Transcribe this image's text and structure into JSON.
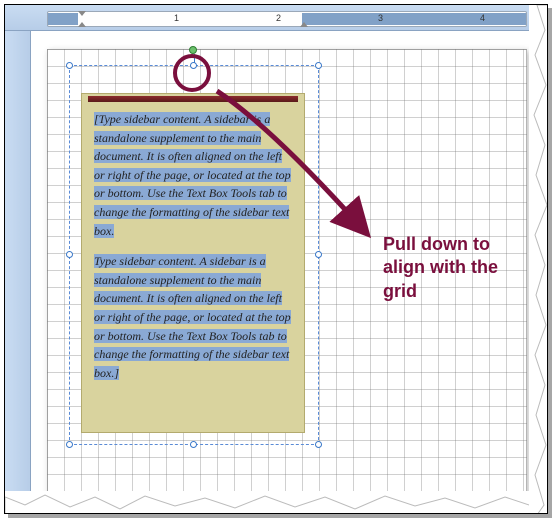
{
  "ruler": {
    "numbers": [
      "1",
      "2",
      "3",
      "4"
    ]
  },
  "textbox": {
    "para1": "[Type sidebar content. A sidebar is a standalone supplement to the main document. It is often aligned on the left or right of the page, or located at the top or bottom. Use the Text Box Tools tab to change the formatting of the sidebar text box.",
    "para2": "Type sidebar content. A sidebar is a standalone supplement to the main document. It is often aligned on the left or right of the page, or located at the top or bottom. Use the Text Box Tools tab to change the formatting of the sidebar text box.]"
  },
  "annotation": {
    "text": "Pull down to align with the grid"
  },
  "colors": {
    "annotation": "#7a0f3d",
    "selection": "#8aa9d4",
    "textbox_bg": "#d9d39e"
  }
}
